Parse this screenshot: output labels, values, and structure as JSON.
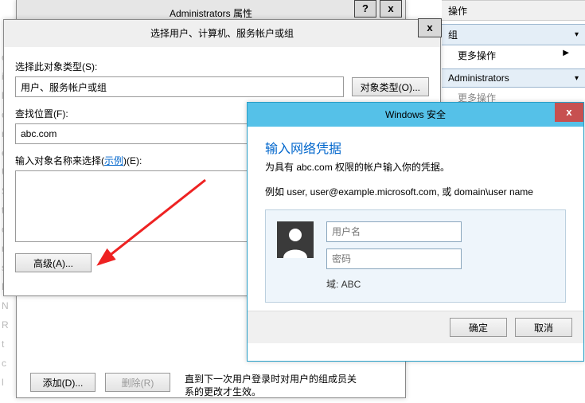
{
  "admin_window": {
    "title": "Administrators 属性",
    "help_glyph": "?",
    "close_glyph": "x"
  },
  "select_window": {
    "title": "选择用户、计算机、服务帐户或组",
    "close_glyph": "x",
    "object_type_label": "选择此对象类型(S):",
    "object_type_value": "用户、服务帐户或组",
    "object_type_btn": "对象类型(O)...",
    "location_label": "查找位置(F):",
    "location_value": "abc.com",
    "names_label_pre": "输入对象名称来选择(",
    "names_label_link": "示例",
    "names_label_post": ")(E):",
    "advanced_btn": "高级(A)..."
  },
  "security_window": {
    "title": "Windows 安全",
    "close_glyph": "x",
    "heading": "输入网络凭据",
    "subheading": "为具有 abc.com 权限的帐户输入你的凭据。",
    "hint": "例如 user, user@example.microsoft.com, 或 domain\\user name",
    "username_placeholder": "用户名",
    "password_placeholder": "密码",
    "domain_label": "域: ABC",
    "ok_btn": "确定",
    "cancel_btn": "取消"
  },
  "bottom": {
    "add_btn": "添加(D)...",
    "remove_btn": "删除(R)",
    "note": "直到下一次用户登录时对用户的组成员关系的更改才生效。"
  },
  "side": {
    "ops": "操作",
    "group": "组",
    "more_ops": "更多操作",
    "admins": "Administrators",
    "more_ops2": "更多操作",
    "tri": "▶",
    "caret": "▾"
  }
}
